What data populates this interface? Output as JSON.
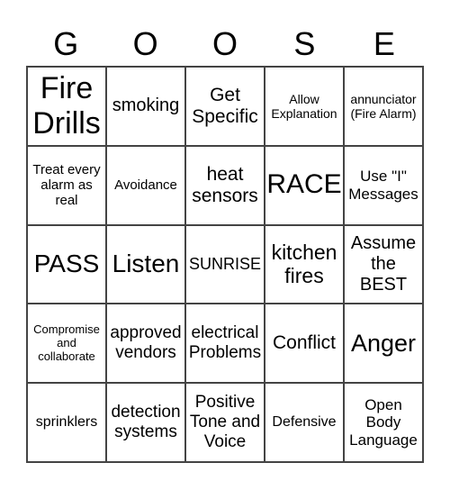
{
  "header": [
    "G",
    "O",
    "O",
    "S",
    "E"
  ],
  "cells": [
    "Fire Drills",
    "smoking",
    "Get Specific",
    "Allow Explanation",
    "annunciator (Fire Alarm)",
    "Treat every alarm as real",
    "Avoidance",
    "heat sensors",
    "RACE",
    "Use \"I\" Messages",
    "PASS",
    "Listen",
    "SUNRISE",
    "kitchen fires",
    "Assume the BEST",
    "Compromise and collaborate",
    "approved vendors",
    "electrical Problems",
    "Conflict",
    "Anger",
    "sprinklers",
    "detection systems",
    "Positive Tone and Voice",
    "Defensive",
    "Open Body Language"
  ]
}
